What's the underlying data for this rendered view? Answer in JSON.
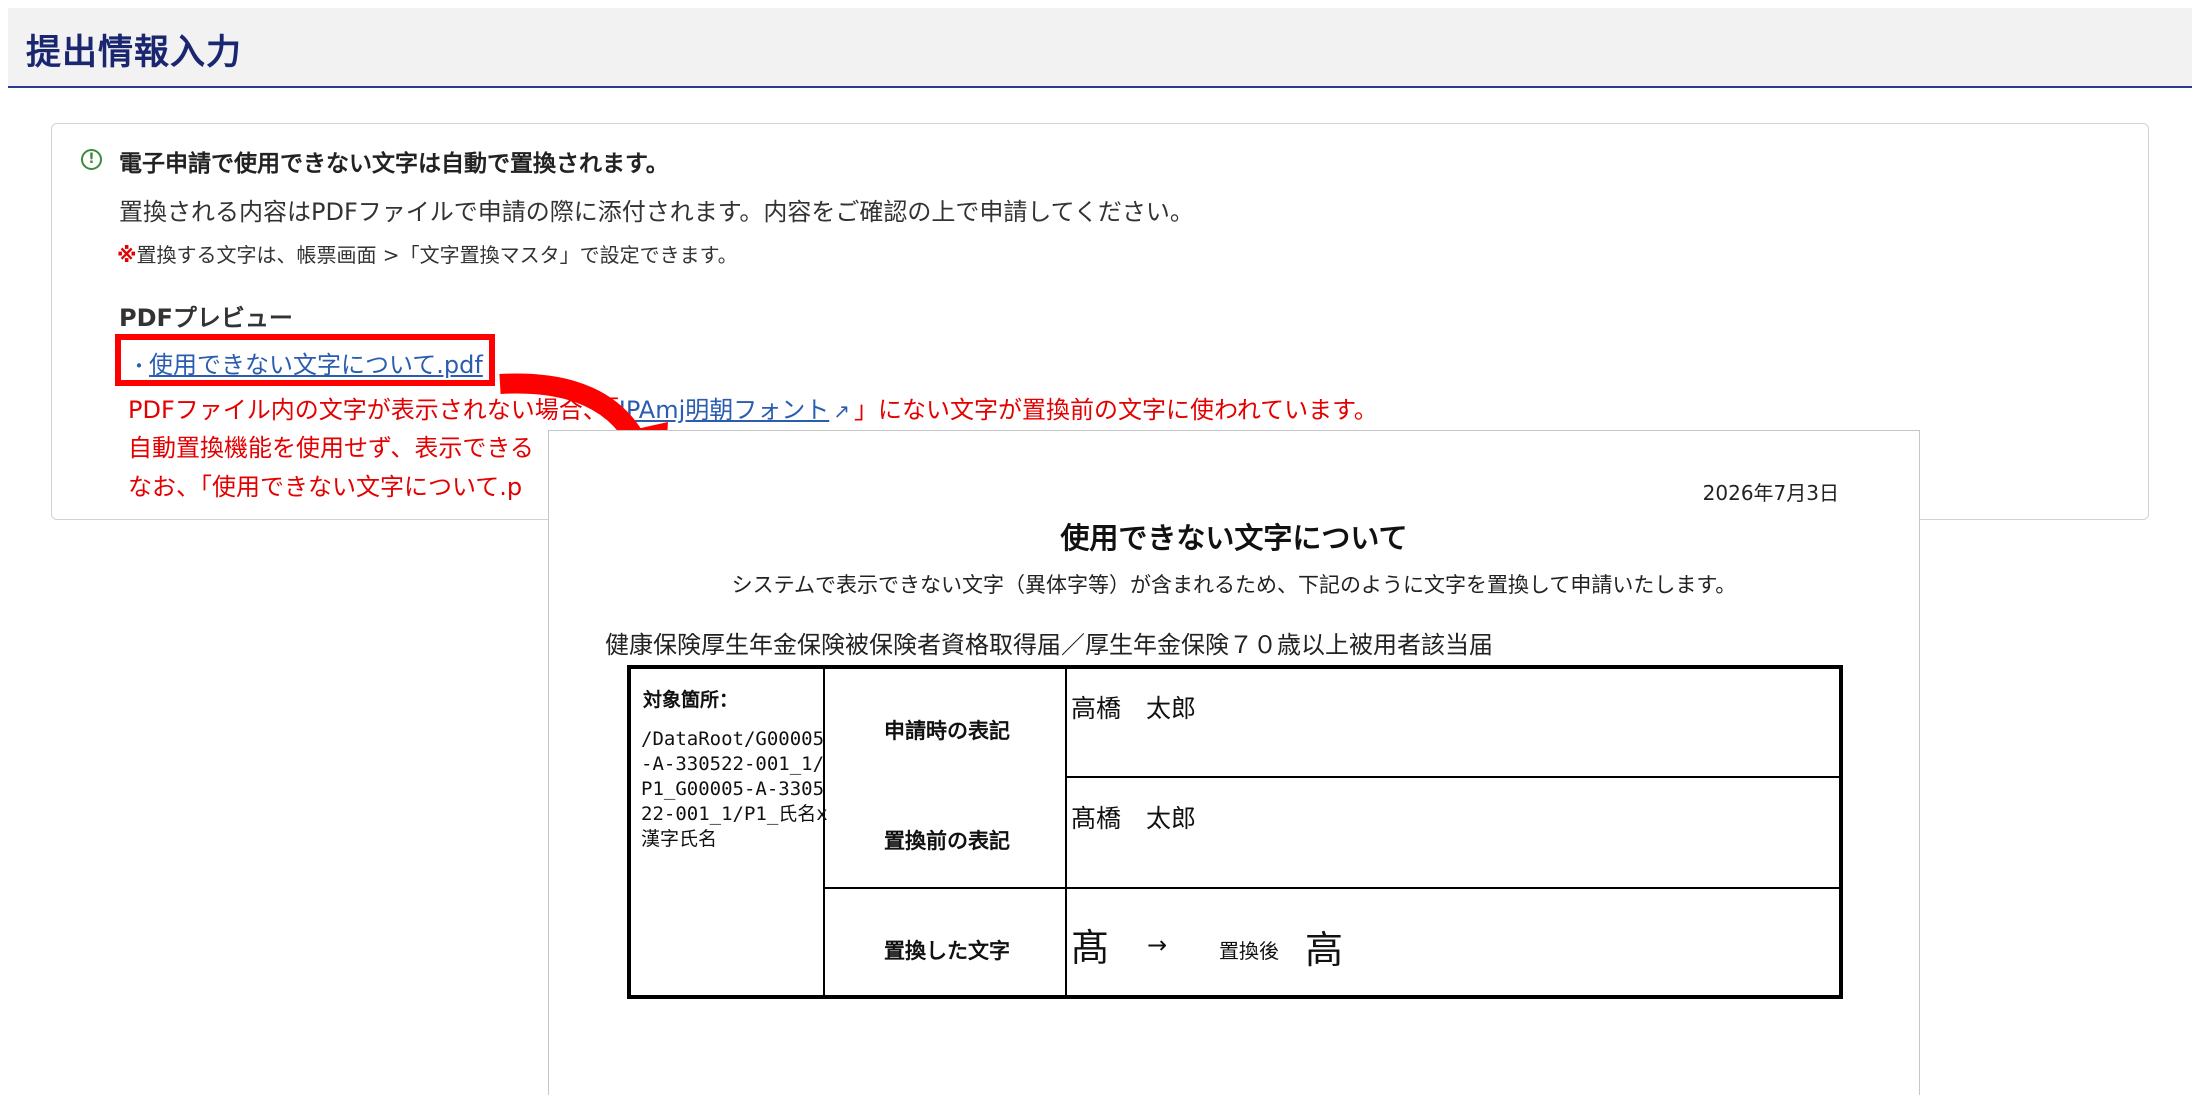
{
  "header": {
    "title": "提出情報入力"
  },
  "notice": {
    "heading": "電子申請で使用できない文字は自動で置換されます。",
    "body": "置換される内容はPDFファイルで申請の際に添付されます。内容をご確認の上で申請してください。",
    "note_mark": "※",
    "note": "置換する文字は、帳票画面 >「文字置換マスタ」で設定できます。",
    "preview_heading": "PDFプレビュー",
    "pdf_bullet": "・",
    "pdf_link": "使用できない文字について.pdf",
    "warning_line1_a": "PDFファイル内の文字が表示されない場合、「",
    "ipa_link": "IPAmj明朝フォント",
    "warning_line1_b": "」にない文字が置換前の文字に使われています。",
    "warning_line2": "自動置換機能を使用せず、表示できる",
    "warning_line3": "なお、「使用できない文字について.p"
  },
  "pdf_preview": {
    "date": "2026年7月3日",
    "title": "使用できない文字について",
    "intro": "システムで表示できない文字（異体字等）が含まれるため、下記のように文字を置換して申請いたします。",
    "form_name": "健康保険厚生年金保険被保険者資格取得届／厚生年金保険７０歳以上被用者該当届",
    "target_label": "対象箇所：",
    "target_path": "/DataRoot/G00005-A-330522-001_1/P1_G00005-A-330522-001_1/P1_氏名x漢字氏名",
    "rows": [
      {
        "label": "申請時の表記",
        "value": "高橋　太郎"
      },
      {
        "label": "置換前の表記",
        "value": "髙橋　太郎"
      },
      {
        "label": "置換した文字",
        "before": "髙",
        "arrow": "→",
        "after_label": "置換後",
        "after": "高"
      }
    ]
  },
  "colors": {
    "header_title": "#1a2670",
    "warning_red": "#e40000",
    "link_blue": "#2a5db0",
    "highlight_red": "#ff0000",
    "info_green": "#3b8b3b"
  }
}
